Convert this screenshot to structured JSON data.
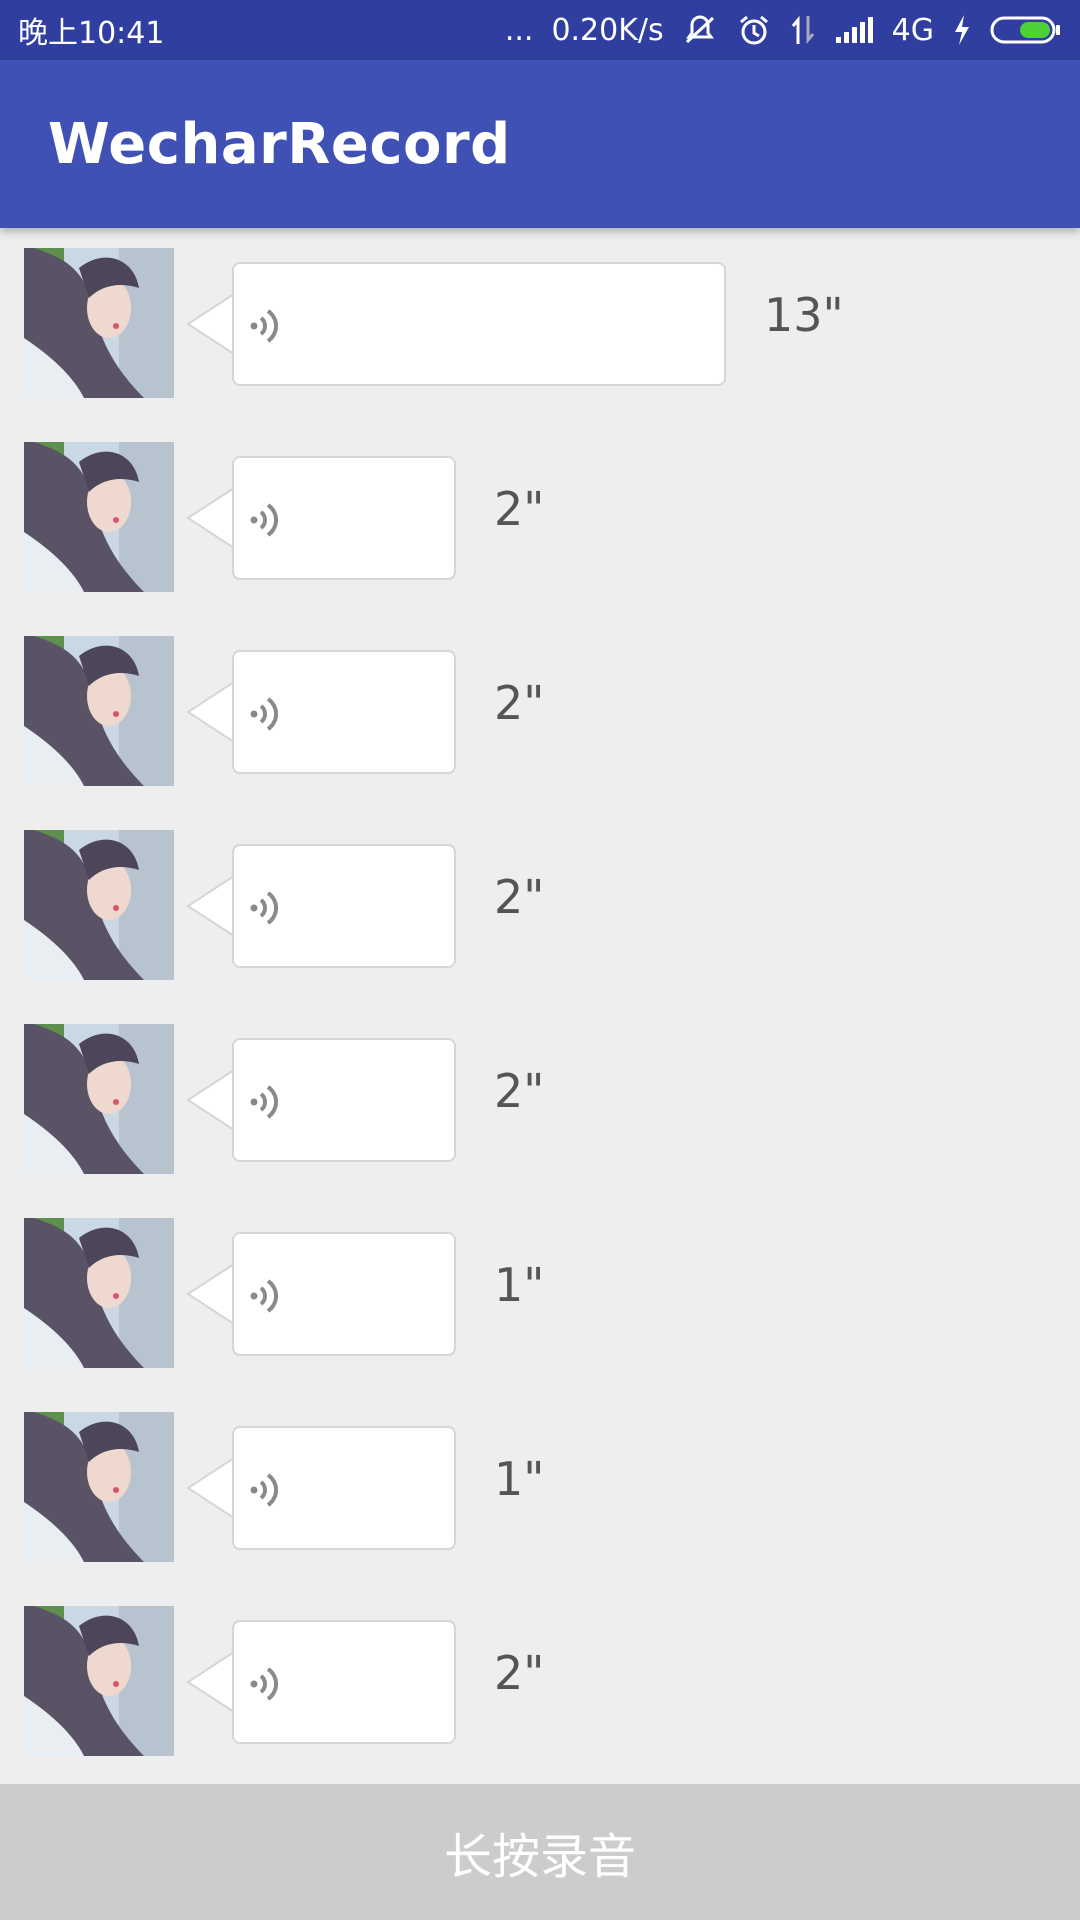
{
  "status_bar": {
    "time": "晚上10:41",
    "more": "...",
    "speed": "0.20K/s",
    "network": "4G"
  },
  "app_bar": {
    "title": "WecharRecord"
  },
  "messages": [
    {
      "duration": "13\""
    },
    {
      "duration": "2\""
    },
    {
      "duration": "2\""
    },
    {
      "duration": "2\""
    },
    {
      "duration": "2\""
    },
    {
      "duration": "1\""
    },
    {
      "duration": "1\""
    },
    {
      "duration": "2\""
    }
  ],
  "record_button": {
    "label": "长按录音"
  },
  "colors": {
    "status_bar": "#303f9f",
    "app_bar": "#3f51b5",
    "background": "#eeeeee",
    "record_button": "#cccccc",
    "battery": "#4cd137"
  }
}
